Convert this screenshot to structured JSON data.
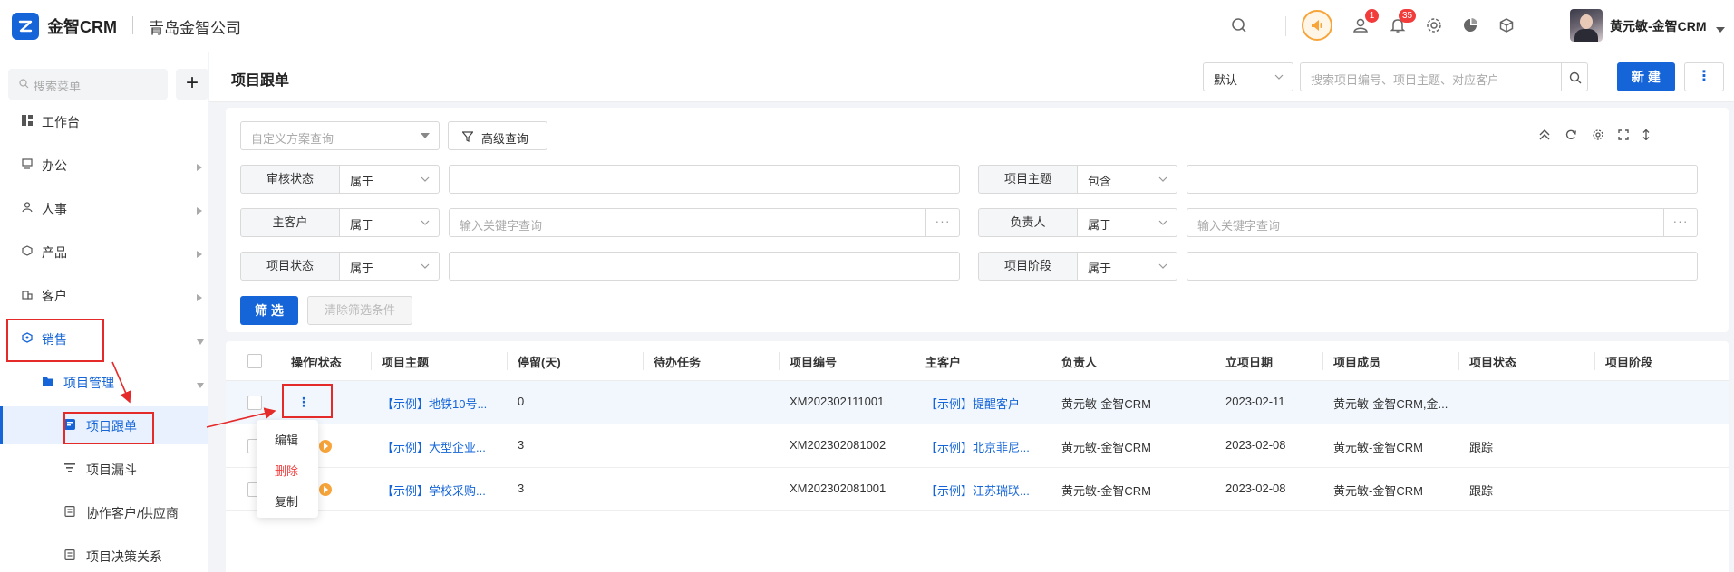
{
  "header": {
    "brand": "金智CRM",
    "company": "青岛金智公司",
    "mail_badge": "1",
    "notify_badge": "35",
    "username": "黄元敏-金智CRM"
  },
  "sidebar": {
    "search_placeholder": "搜索菜单",
    "add_label": "+",
    "items": [
      {
        "label": "工作台",
        "icon": "dashboard-icon"
      },
      {
        "label": "办公",
        "icon": "monitor-icon"
      },
      {
        "label": "人事",
        "icon": "people-icon"
      },
      {
        "label": "产品",
        "icon": "box-icon"
      },
      {
        "label": "客户",
        "icon": "building-icon"
      },
      {
        "label": "销售",
        "icon": "sales-icon"
      },
      {
        "label": "项目管理",
        "icon": "folder-icon"
      },
      {
        "label": "项目跟单",
        "icon": "tracking-icon"
      },
      {
        "label": "项目漏斗",
        "icon": "funnel-icon"
      },
      {
        "label": "协作客户/供应商",
        "icon": "document-icon"
      },
      {
        "label": "项目决策关系",
        "icon": "document-icon"
      }
    ]
  },
  "page": {
    "title": "项目跟单",
    "view_select": "默认",
    "search_placeholder": "搜索项目编号、项目主题、对应客户",
    "new_label": "新 建",
    "more_label": "⋮"
  },
  "filters": {
    "scheme_placeholder": "自定义方案查询",
    "advanced_label": "高级查询",
    "rows": [
      {
        "label": "审核状态",
        "op": "属于",
        "placeholder": ""
      },
      {
        "label": "项目主题",
        "op": "包含",
        "placeholder": ""
      },
      {
        "label": "主客户",
        "op": "属于",
        "placeholder": "输入关键字查询"
      },
      {
        "label": "负责人",
        "op": "属于",
        "placeholder": "输入关键字查询"
      },
      {
        "label": "项目状态",
        "op": "属于",
        "placeholder": ""
      },
      {
        "label": "项目阶段",
        "op": "属于",
        "placeholder": ""
      }
    ],
    "dots_label": "···",
    "filter_label": "筛 选",
    "clear_label": "清除筛选条件"
  },
  "table": {
    "columns": [
      "操作/状态",
      "项目主题",
      "停留(天)",
      "待办任务",
      "项目编号",
      "主客户",
      "负责人",
      "立项日期",
      "项目成员",
      "项目状态",
      "项目阶段"
    ],
    "rows": [
      {
        "subject": "【示例】地铁10号...",
        "stay": "0",
        "todo": "",
        "code": "XM202302111001",
        "customer": "【示例】提醒客户",
        "owner": "黄元敏-金智CRM",
        "date": "2023-02-11",
        "members": "黄元敏-金智CRM,金...",
        "status": "",
        "stage": ""
      },
      {
        "subject": "【示例】大型企业...",
        "stay": "3",
        "todo": "",
        "code": "XM202302081002",
        "customer": "【示例】北京菲尼...",
        "owner": "黄元敏-金智CRM",
        "date": "2023-02-08",
        "members": "黄元敏-金智CRM",
        "status": "跟踪",
        "stage": ""
      },
      {
        "subject": "【示例】学校采购...",
        "stay": "3",
        "todo": "",
        "code": "XM202302081001",
        "customer": "【示例】江苏瑞联...",
        "owner": "黄元敏-金智CRM",
        "date": "2023-02-08",
        "members": "黄元敏-金智CRM",
        "status": "跟踪",
        "stage": ""
      }
    ]
  },
  "dropdown": {
    "edit": "编辑",
    "delete": "删除",
    "copy": "复制"
  },
  "colors": {
    "primary": "#1565d8",
    "danger": "#f23c3c",
    "annotation": "#e52a2a",
    "status": "#f7a53a"
  }
}
